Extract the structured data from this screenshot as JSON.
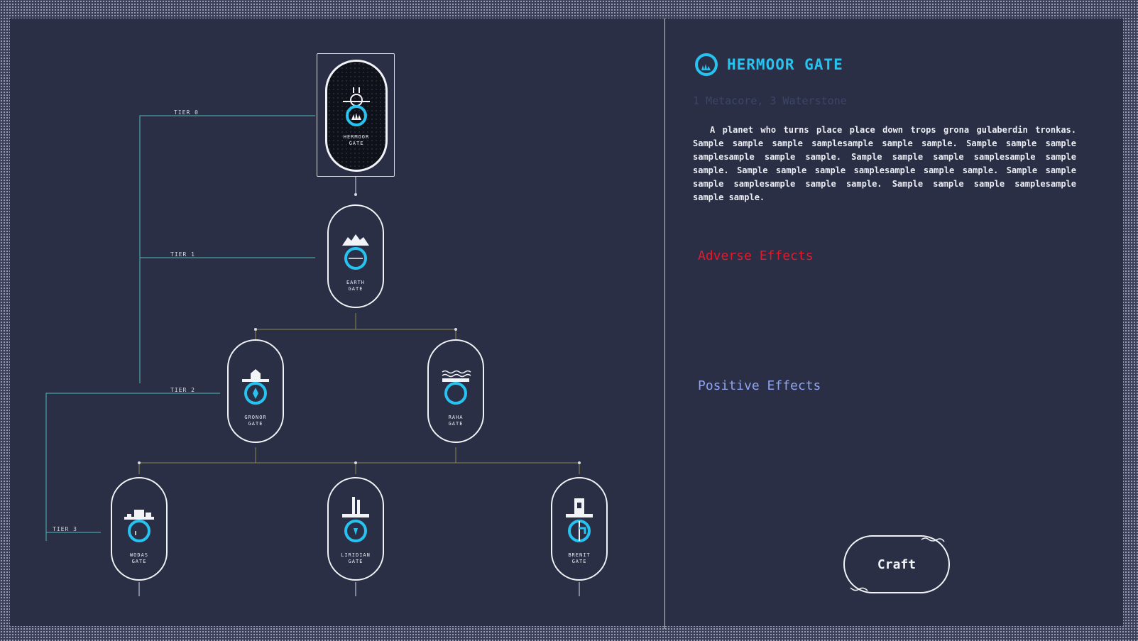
{
  "tree": {
    "tiers": [
      {
        "label": "TIER 0"
      },
      {
        "label": "TIER 1"
      },
      {
        "label": "TIER 2"
      },
      {
        "label": "TIER 3"
      }
    ],
    "nodes": {
      "hermoor": {
        "label": "HERMOOR\nGATE",
        "selected": true
      },
      "earth": {
        "label": "EARTH\nGATE"
      },
      "gronor": {
        "label": "GRONOR\nGATE"
      },
      "raha": {
        "label": "RAHA\nGATE"
      },
      "wodas": {
        "label": "WODAS\nGATE"
      },
      "liridian": {
        "label": "LIRIDIAN\nGATE"
      },
      "brenit": {
        "label": "BRENIT\nGATE"
      }
    }
  },
  "detail": {
    "title": "HERMOOR GATE",
    "title_icon": "hermoor-ring-icon",
    "recipe": "1 Metacore, 3 Waterstone",
    "description": "A planet who turns place place down trops grona gulaberdin tronkas. Sample sample sample samplesample sample sample. Sample sample sample samplesample sample sample. Sample sample sample samplesample sample sample. Sample sample sample samplesample sample sample. Sample sample sample samplesample sample sample. Sample sample sample samplesample sample sample.",
    "adverse_label": "Adverse Effects",
    "positive_label": "Positive Effects",
    "craft_label": "Craft"
  },
  "colors": {
    "background": "#2a2f46",
    "accent": "#27c3f0",
    "adverse": "#e8182b",
    "positive": "#8fa4f2",
    "tier_line": "#4fb8b8",
    "branch_line": "#7a7a3a"
  }
}
